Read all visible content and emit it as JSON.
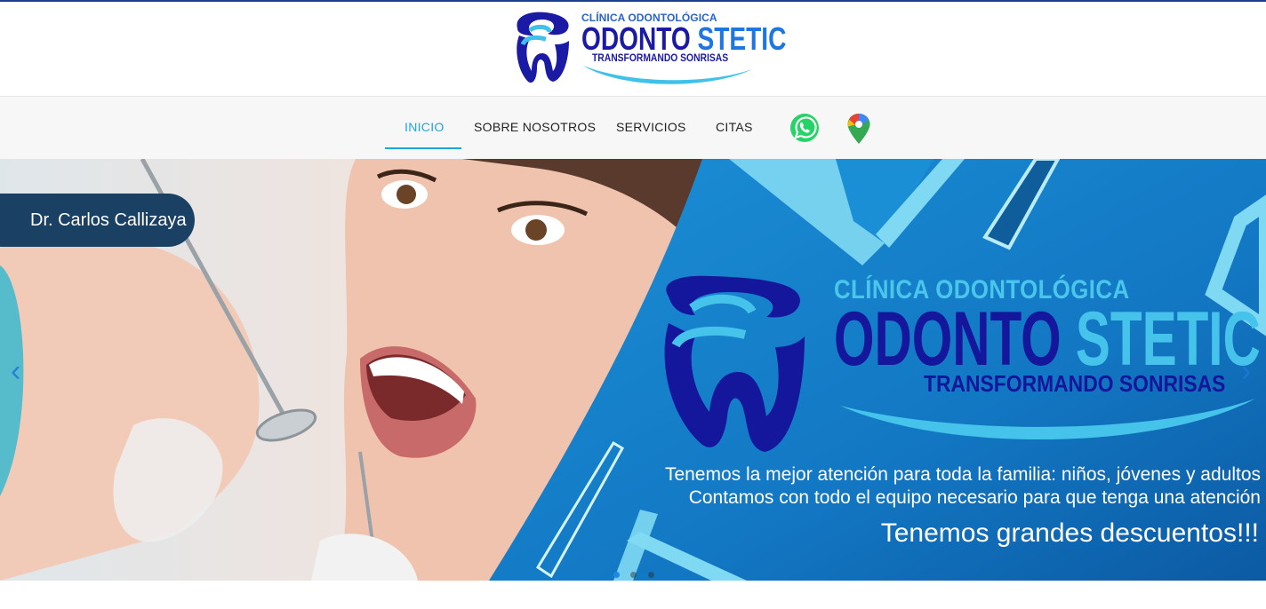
{
  "logo": {
    "line_top": "CLÍNICA ODONTOLÓGICA",
    "name_part1": "ODONTO",
    "name_part2": "STETIC",
    "tagline": "TRANSFORMANDO SONRISAS"
  },
  "nav": {
    "items": [
      {
        "label": "INICIO",
        "active": true
      },
      {
        "label": "SOBRE NOSOTROS"
      },
      {
        "label": "SERVICIOS"
      },
      {
        "label": "CITAS"
      }
    ],
    "icons": [
      "whatsapp-icon",
      "google-maps-icon"
    ]
  },
  "hero": {
    "doctor": "Dr. Carlos Callizaya",
    "logo_top": "CLÍNICA ODONTOLÓGICA",
    "logo_part1": "ODONTO",
    "logo_part2": "STETIC",
    "logo_tagline": "TRANSFORMANDO SONRISAS",
    "line1": "Tenemos la mejor atención para toda la familia: niños, jóvenes y adultos",
    "line2": "Contamos con todo el equipo necesario para que tenga una atención",
    "line3": "Tenemos grandes descuentos!!!",
    "prev_arrow": "‹",
    "next_arrow": "›",
    "slides_count": 3,
    "active_slide": 1
  },
  "colors": {
    "brand_dark_blue": "#1a1aa5",
    "brand_light_blue": "#45c3ea",
    "nav_active": "#1ea7d8",
    "doctor_tag_bg": "#1a4064"
  }
}
